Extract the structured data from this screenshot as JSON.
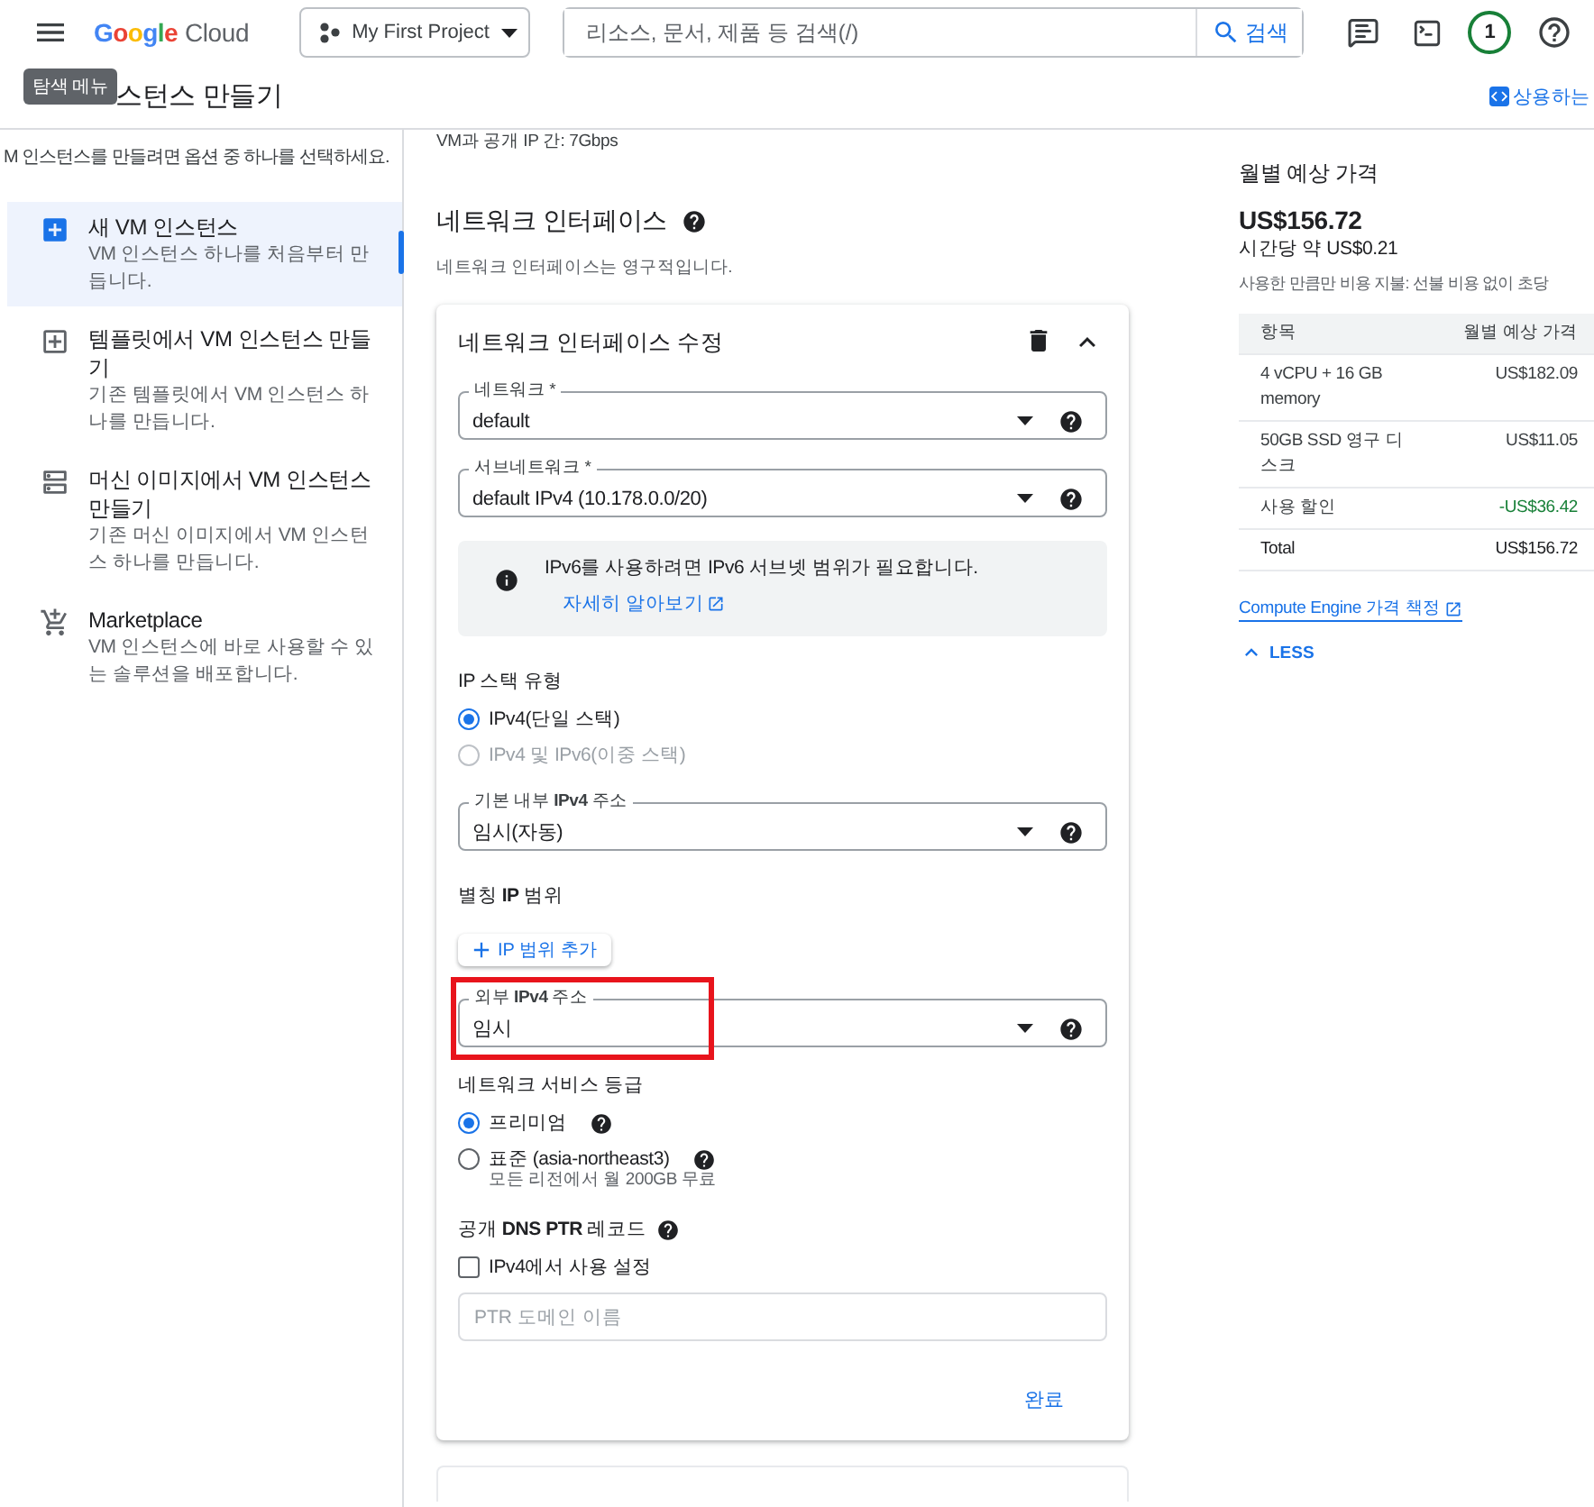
{
  "header": {
    "logo_word": "Google",
    "logo_product": "Cloud",
    "project": "My First Project",
    "search": {
      "placeholder": "리소스, 문서, 제품 등 검색(/)",
      "button": "검색"
    },
    "avatar": "1"
  },
  "page": {
    "title": "스턴스 만들기",
    "tooltip": "탐색 메뉴",
    "top_link": "상용하는"
  },
  "sidebar": {
    "intro": "M 인스턴스를 만들려면 옵션 중 하나를 선택하세요.",
    "items": [
      {
        "kind": "new",
        "title": "새 VM 인스턴스",
        "description": "VM 인스턴스 하나를 처음부터 만듭니다.",
        "selected": true
      },
      {
        "kind": "template",
        "title": "템플릿에서 VM 인스턴스 만들기",
        "description": "기존 템플릿에서 VM 인스턴스 하나를 만듭니다.",
        "selected": false
      },
      {
        "kind": "image",
        "title": "머신 이미지에서 VM 인스턴스 만들기",
        "description": "기존 머신 이미지에서 VM 인스턴스 하나를 만듭니다.",
        "selected": false
      },
      {
        "kind": "marketplace",
        "title": "Marketplace",
        "description": "VM 인스턴스에 바로 사용할 수 있는 솔루션을 배포합니다.",
        "selected": false
      }
    ]
  },
  "network": {
    "intro_lines": [
      "VM과 공개 IP 간: 7Gbps"
    ],
    "heading": "네트워크 인터페이스",
    "note": "네트워크 인터페이스는 영구적입니다.",
    "card": {
      "title": "네트워크 인터페이스 수정",
      "network": {
        "label": "네트워크 *",
        "value": "default"
      },
      "subnetwork": {
        "label": "서브네트워크 *",
        "value": "default IPv4 (10.178.0.0/20)"
      },
      "info": {
        "text": "IPv6를 사용하려면 IPv6 서브넷 범위가 필요합니다.",
        "link": "자세히 알아보기"
      },
      "ip_stack": {
        "label": "IP 스택 유형",
        "options": [
          {
            "label": "IPv4(단일 스택)",
            "selected": true,
            "disabled": false
          },
          {
            "label": "IPv4 및 IPv6(이중 스택)",
            "selected": false,
            "disabled": true
          }
        ]
      },
      "internal_ip": {
        "label": "기본 내부 **IPv4** 주소",
        "value": "임시(자동)"
      },
      "alias": {
        "label": "별칭 **IP** 범위",
        "button": "IP 범위 추가"
      },
      "external_ip": {
        "label": "외부 **IPv4** 주소",
        "value": "임시",
        "highlighted": true
      },
      "tier": {
        "label": "네트워크 서비스 등급",
        "options": [
          {
            "label": "프리미엄",
            "selected": true
          },
          {
            "label": "표준 (asia-northeast3)",
            "note": "모든 리전에서 월 200GB 무료",
            "selected": false
          }
        ]
      },
      "ptr": {
        "label": "공개 **DNS PTR** 레코드",
        "checkbox": {
          "label": "IPv4에서 사용 설정",
          "checked": false
        },
        "placeholder": "PTR 도메인 이름"
      },
      "done": "완료"
    }
  },
  "pricing": {
    "heading": "월별 예상 가격",
    "total": "US$156.72",
    "hourly": "시간당 약 US$0.21",
    "description": "사용한 만큼만 비용 지불: 선불 비용 없이 초당",
    "columns": [
      "항목",
      "월별 예상 가격"
    ],
    "rows": [
      {
        "kind": "normal",
        "item": "4 vCPU + 16 GB memory",
        "price": "US$182.09"
      },
      {
        "kind": "normal",
        "item": "50GB SSD 영구 디스크",
        "price": "US$11.05"
      },
      {
        "kind": "discount",
        "item": "사용 할인",
        "price": "-US$36.42"
      },
      {
        "kind": "total",
        "item": "Total",
        "price": "US$156.72"
      }
    ],
    "link": "Compute Engine 가격 책정",
    "less": "LESS"
  }
}
